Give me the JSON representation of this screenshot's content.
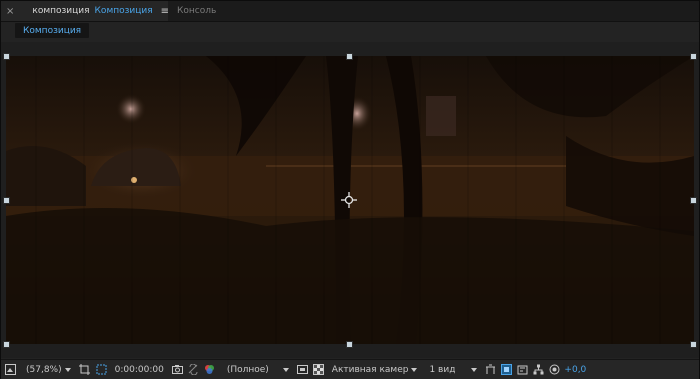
{
  "panel": {
    "tabs": [
      {
        "close": "×",
        "title": "композиция",
        "link": "Композиция",
        "menu": "≡"
      },
      {
        "title": "Консоль"
      }
    ],
    "breadcrumb": "Композиция"
  },
  "toolbar": {
    "zoom": "(57,8%)",
    "timecode": "0:00:00:00",
    "resolution": "(Полное)",
    "camera": "Активная камер",
    "views": "1 вид",
    "exposure": "+0,0"
  },
  "colors": {
    "accent": "#4aa4e8",
    "label_chip": "#b8a57c",
    "background": "#232323"
  },
  "icons": [
    "close-icon",
    "label-color-icon",
    "lock-icon",
    "panel-menu-icon",
    "preview-toggle-icon",
    "zoom-dropdown-icon",
    "region-of-interest-icon",
    "mask-path-icon",
    "snapshot-icon",
    "show-snapshot-icon",
    "color-channels-icon",
    "resolution-dropdown-icon",
    "transparency-grid-icon",
    "camera-dropdown-icon",
    "view-layout-dropdown-icon",
    "toggle-pixel-aspect-icon",
    "fast-preview-icon",
    "timeline-icon",
    "flowchart-icon",
    "reset-exposure-icon"
  ]
}
